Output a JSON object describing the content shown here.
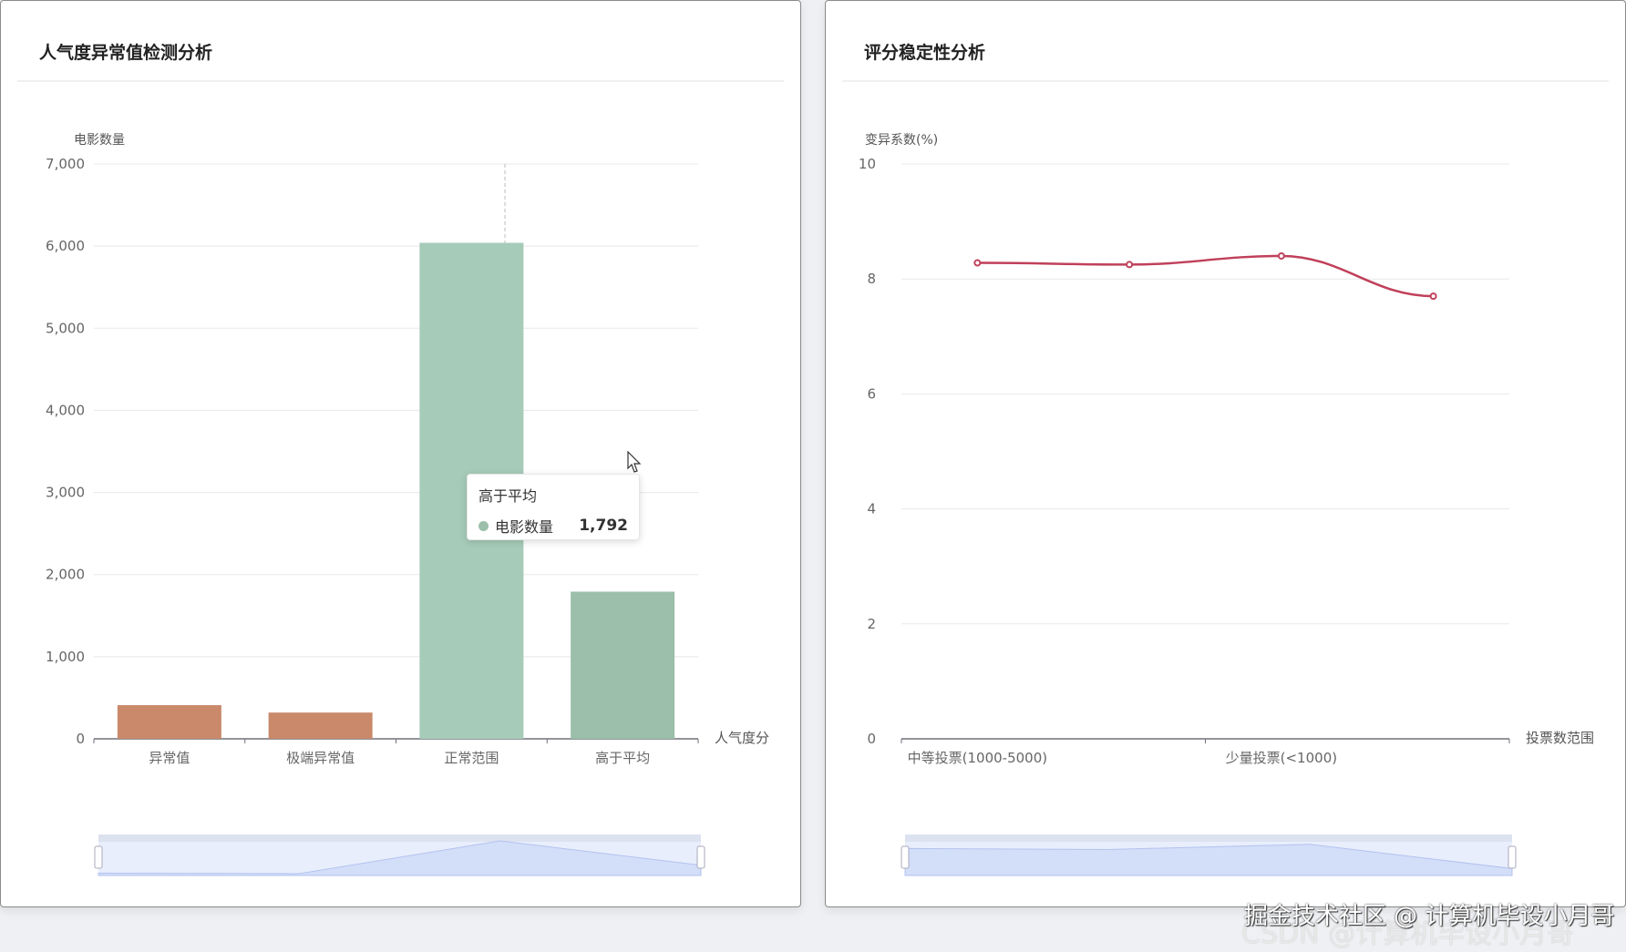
{
  "watermark": "掘金技术社区 @ 计算机毕设小月哥",
  "watermark_back": "CSDN @计算机毕设小月哥",
  "tooltip": {
    "title": "高于平均",
    "series": "电影数量",
    "value": "1,792"
  },
  "chart_data": [
    {
      "type": "bar",
      "title": "人气度异常值检测分析",
      "ylabel": "电影数量",
      "xlabel": "人气度分",
      "categories": [
        "异常值",
        "极端异常值",
        "正常范围",
        "高于平均"
      ],
      "values": [
        410,
        320,
        6040,
        1792
      ],
      "colors": [
        "#c9896a",
        "#c9896a",
        "#a6cbb9",
        "#9bbfaa"
      ],
      "ylim": [
        0,
        7000
      ],
      "yticks": [
        "0",
        "1,000",
        "2,000",
        "3,000",
        "4,000",
        "5,000",
        "6,000",
        "7,000"
      ],
      "grid": true,
      "datazoom": true
    },
    {
      "type": "line",
      "title": "评分稳定性分析",
      "ylabel": "变异系数(%)",
      "xlabel": "投票数范围",
      "categories": [
        "中等投票(1000-5000)",
        "",
        "少量投票(<1000)",
        ""
      ],
      "values": [
        8.28,
        8.25,
        8.4,
        7.7
      ],
      "color": "#c0405a",
      "ylim": [
        0,
        10
      ],
      "yticks": [
        "0",
        "2",
        "4",
        "6",
        "8",
        "10"
      ],
      "grid": true,
      "smooth": true,
      "datazoom": true
    }
  ]
}
